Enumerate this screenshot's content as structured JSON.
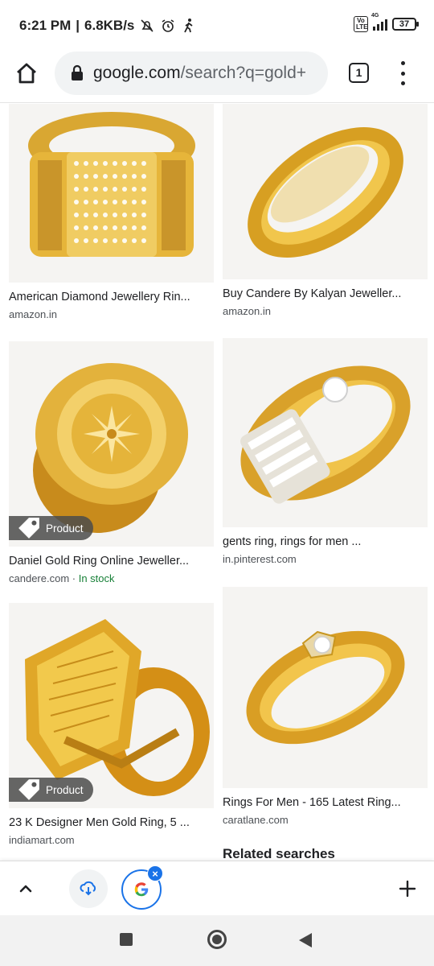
{
  "status_bar": {
    "time": "6:21 PM",
    "separator": "|",
    "speed": "6.8KB/s",
    "network": "4G",
    "volte": "Vo LTE",
    "battery": "37"
  },
  "browser": {
    "url_domain": "google.com",
    "url_path": "/search?q=gold+",
    "tab_count": "1"
  },
  "results": [
    {
      "title": "American Diamond Jewellery Rin...",
      "source": "amazon.in",
      "stock": "",
      "badge": ""
    },
    {
      "title": "Buy Candere By Kalyan Jeweller...",
      "source": "amazon.in",
      "stock": "",
      "badge": ""
    },
    {
      "title": "Daniel Gold Ring Online Jeweller...",
      "source": "candere.com",
      "stock": "In stock",
      "badge": "Product"
    },
    {
      "title": "gents ring, rings for men ...",
      "source": "in.pinterest.com",
      "stock": "",
      "badge": ""
    },
    {
      "title": "23 K Designer Men Gold Ring, 5 ...",
      "source": "indiamart.com",
      "stock": "",
      "badge": "Product"
    },
    {
      "title": "Rings For Men - 165 Latest Ring...",
      "source": "caratlane.com",
      "stock": "",
      "badge": ""
    }
  ],
  "source_separator": " · ",
  "related_searches": "Related searches",
  "colors": {
    "gold": "#e8b92f",
    "gold_dark": "#b9861a",
    "google_blue": "#1a73e8",
    "in_stock_green": "#188038"
  },
  "icons": [
    "home-icon",
    "lock-icon",
    "tab-switcher-icon",
    "overflow-menu-icon",
    "chevron-up-icon",
    "download-icon",
    "google-icon",
    "close-icon",
    "plus-icon",
    "tag-icon"
  ]
}
